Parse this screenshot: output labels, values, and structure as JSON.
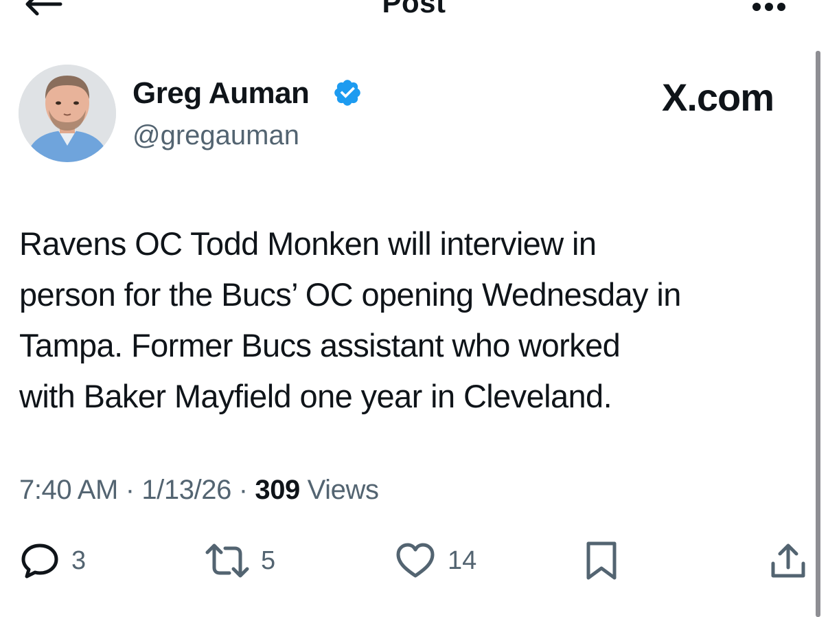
{
  "header": {
    "title": "Post",
    "back_icon": "arrow-left-icon",
    "more_icon": "more-horizontal-icon"
  },
  "author": {
    "display_name": "Greg Auman",
    "handle": "@gregauman",
    "verified": true,
    "verified_color": "#1d9bf0"
  },
  "watermark": "X.com",
  "tweet": {
    "lines": [
      "Ravens OC Todd Monken will interview in",
      "person for the Bucs’ OC opening Wednesday in",
      "Tampa. Former Bucs assistant who worked",
      "with Baker Mayfield one year in Cleveland."
    ]
  },
  "meta": {
    "time": "7:40 AM",
    "separator": "·",
    "date": "1/13/26",
    "views_count": "309",
    "views_label": "Views"
  },
  "actions": {
    "reply_count": "3",
    "repost_count": "5",
    "like_count": "14"
  },
  "colors": {
    "text_primary": "#0f1419",
    "text_secondary": "#536471",
    "accent": "#1d9bf0"
  }
}
